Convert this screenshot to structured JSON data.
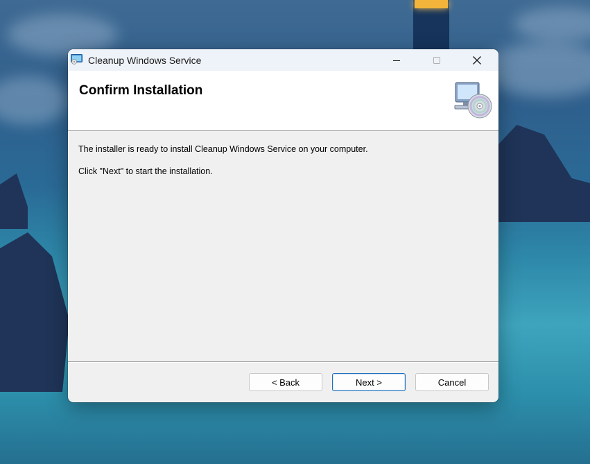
{
  "window": {
    "title": "Cleanup Windows Service",
    "controls": {
      "minimize": "—",
      "maximize": "☐",
      "close": "✕"
    }
  },
  "header": {
    "title": "Confirm Installation",
    "icon": "computer-cd-icon"
  },
  "body": {
    "line1": "The installer is ready to install Cleanup Windows Service on your computer.",
    "line2": "Click \"Next\" to start the installation."
  },
  "buttons": {
    "back": "< Back",
    "next": "Next >",
    "cancel": "Cancel"
  },
  "colors": {
    "accent": "#1e6fbf",
    "titlebar": "#eef3f9",
    "dialog_bg": "#f0f0f0"
  }
}
